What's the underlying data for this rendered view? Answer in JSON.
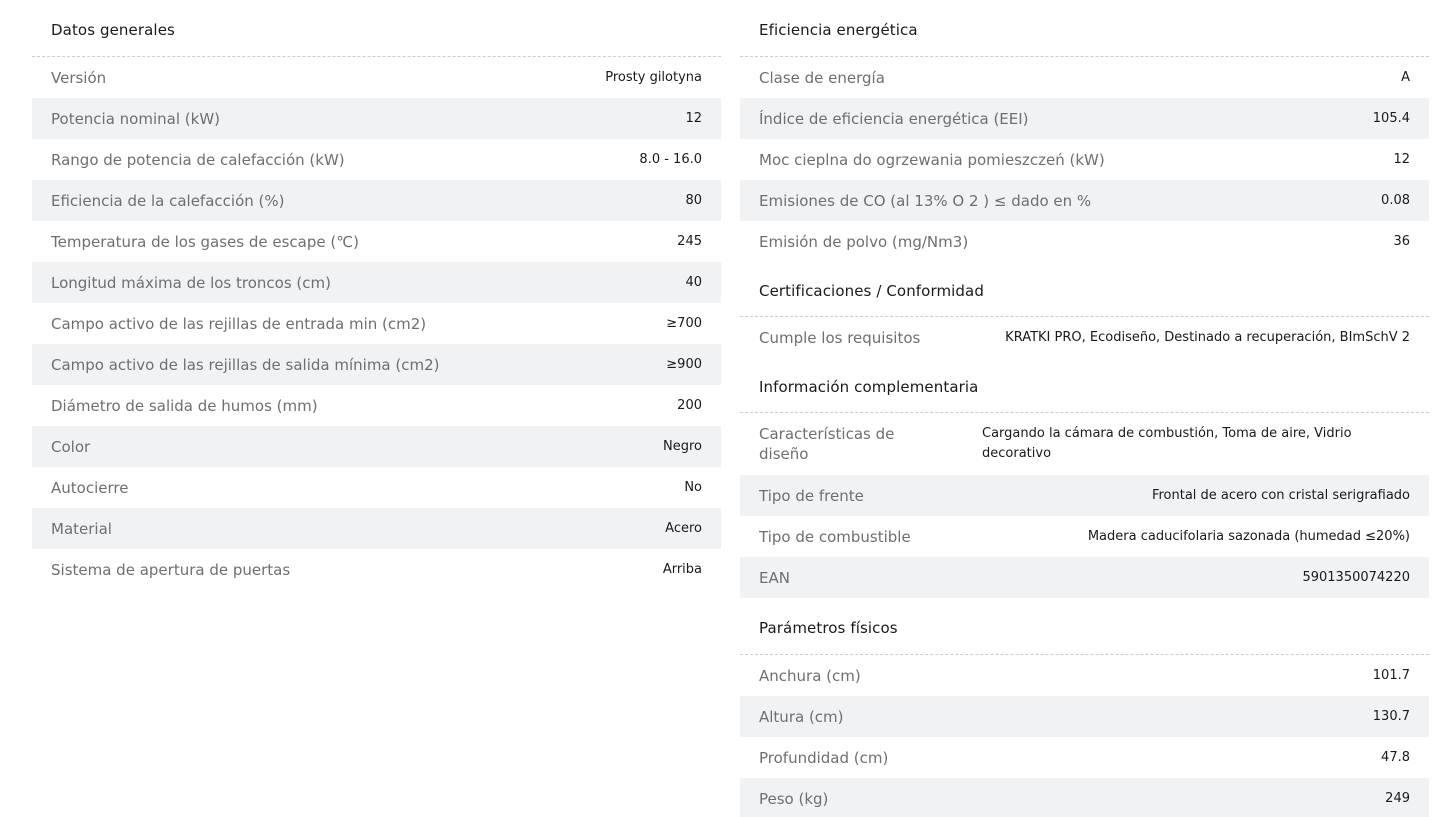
{
  "left": {
    "title": "Datos generales",
    "rows": [
      {
        "label": "Versión",
        "value": "Prosty gilotyna"
      },
      {
        "label": "Potencia nominal (kW)",
        "value": "12"
      },
      {
        "label": "Rango de potencia de calefacción (kW)",
        "value": "8.0 - 16.0"
      },
      {
        "label": "Eficiencia de la calefacción (%)",
        "value": "80"
      },
      {
        "label": "Temperatura de los gases de escape (℃)",
        "value": "245"
      },
      {
        "label": "Longitud máxima de los troncos (cm)",
        "value": "40"
      },
      {
        "label": "Campo activo de las rejillas de entrada min (cm2)",
        "value": "≥700"
      },
      {
        "label": "Campo activo de las rejillas de salida mínima (cm2)",
        "value": "≥900"
      },
      {
        "label": "Diámetro de salida de humos (mm)",
        "value": "200"
      },
      {
        "label": "Color",
        "value": "Negro"
      },
      {
        "label": "Autocierre",
        "value": "No"
      },
      {
        "label": "Material",
        "value": "Acero"
      },
      {
        "label": "Sistema de apertura de puertas",
        "value": "Arriba"
      }
    ]
  },
  "energy": {
    "title": "Eficiencia energética",
    "rows": [
      {
        "label": "Clase de energía",
        "value": "A"
      },
      {
        "label": "Índice de eficiencia energética (EEI)",
        "value": "105.4"
      },
      {
        "label": "Moc cieplna do ogrzewania pomieszczeń (kW)",
        "value": "12"
      },
      {
        "label": "Emisiones de CO (al 13% O 2 ) ≤ dado en %",
        "value": "0.08"
      },
      {
        "label": "Emisión de polvo (mg/Nm3)",
        "value": "36"
      }
    ]
  },
  "certs": {
    "title": "Certificaciones / Conformidad",
    "rows": [
      {
        "label": "Cumple los requisitos",
        "value": "KRATKI PRO, Ecodiseño, Destinado a recuperación, BImSchV 2"
      }
    ]
  },
  "extra": {
    "title": "Información complementaria",
    "rows": [
      {
        "label": "Características de diseño",
        "value": "Cargando la cámara de combustión, Toma de aire, Vidrio decorativo"
      },
      {
        "label": "Tipo de frente",
        "value": "Frontal de acero con cristal serigrafiado"
      },
      {
        "label": "Tipo de combustible",
        "value": "Madera caducifolaria sazonada (humedad ≤20%)"
      },
      {
        "label": "EAN",
        "value": "5901350074220"
      }
    ]
  },
  "physical": {
    "title": "Parámetros físicos",
    "rows": [
      {
        "label": "Anchura (cm)",
        "value": "101.7"
      },
      {
        "label": "Altura (cm)",
        "value": "130.7"
      },
      {
        "label": "Profundidad (cm)",
        "value": "47.8"
      },
      {
        "label": "Peso (kg)",
        "value": "249"
      }
    ]
  }
}
